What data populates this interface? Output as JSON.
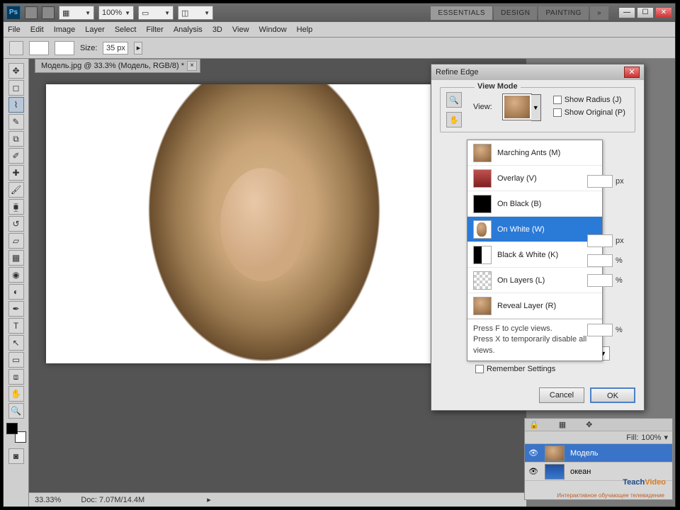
{
  "titlebar": {
    "zoom_select": "100%"
  },
  "workspace": {
    "tabs": [
      "ESSENTIALS",
      "DESIGN",
      "PAINTING"
    ],
    "active": 0,
    "more": "»"
  },
  "menu": [
    "File",
    "Edit",
    "Image",
    "Layer",
    "Select",
    "Filter",
    "Analysis",
    "3D",
    "View",
    "Window",
    "Help"
  ],
  "options": {
    "size_label": "Size:",
    "size_value": "35 px"
  },
  "doc_tab": "Модель.jpg @ 33.3% (Модель, RGB/8) *",
  "status": {
    "zoom": "33.33%",
    "doc": "Doc: 7.07M/14.4M"
  },
  "dialog": {
    "title": "Refine Edge",
    "view_mode_legend": "View Mode",
    "view_label": "View:",
    "show_radius": "Show Radius (J)",
    "show_original": "Show Original (P)",
    "modes": [
      {
        "label": "Marching Ants (M)",
        "thumb": "th-ma"
      },
      {
        "label": "Overlay (V)",
        "thumb": "th-ov"
      },
      {
        "label": "On Black (B)",
        "thumb": "th-bk"
      },
      {
        "label": "On White (W)",
        "thumb": "th-wh"
      },
      {
        "label": "Black & White (K)",
        "thumb": "th-bw"
      },
      {
        "label": "On Layers (L)",
        "thumb": "th-ly"
      },
      {
        "label": "Reveal Layer (R)",
        "thumb": "th-rv"
      }
    ],
    "selected_mode": 3,
    "hint1": "Press F to cycle views.",
    "hint2": "Press X to temporarily disable all views.",
    "units": {
      "px": "px",
      "pct": "%"
    },
    "remember": "Remember Settings",
    "cancel": "Cancel",
    "ok": "OK"
  },
  "layers": {
    "fill_label": "Fill:",
    "fill_value": "100%",
    "items": [
      {
        "name": "Модель",
        "active": true,
        "thumb": "lt1"
      },
      {
        "name": "океан",
        "active": false,
        "thumb": "lt2"
      }
    ]
  },
  "watermark": {
    "brand_a": "Teach",
    "brand_b": "Video",
    "sub": "Интерактивное обучающее телевидение"
  }
}
